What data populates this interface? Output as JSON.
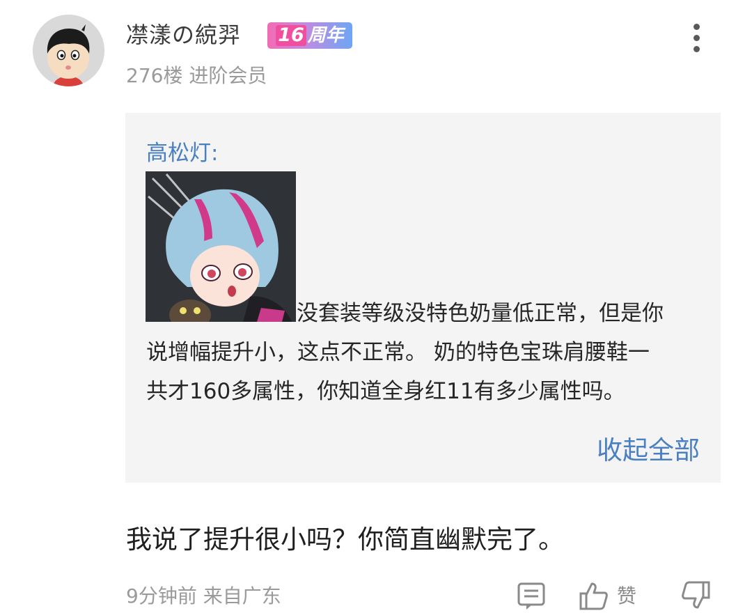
{
  "comment": {
    "username": "凚漾の綂羿",
    "anniversary_badge": {
      "number": "16",
      "label": "周年"
    },
    "floor_and_level": "276楼 进阶会员",
    "quote": {
      "author": "高松灯:",
      "lines": [
        "没套装等级没特色奶量低正常，但是你",
        "说增幅提升小，这点不正常。 奶的特色宝珠肩腰鞋一",
        "共才160多属性，你知道全身红11有多少属性吗。"
      ],
      "collapse_label": "收起全部"
    },
    "reply": "我说了提升很小吗？你简直幽默完了。",
    "time_and_location": "9分钟前 来自广东",
    "like_label": "赞"
  },
  "colors": {
    "link_blue": "#4a7fc1",
    "quote_background": "#f4f4f4",
    "meta_gray": "#9a9a9a",
    "badge_gradient": [
      "#f36bb4",
      "#6ea6f4"
    ]
  },
  "icons": [
    "more-vertical-icon",
    "comment-icon",
    "thumbs-up-icon",
    "thumbs-down-icon"
  ]
}
